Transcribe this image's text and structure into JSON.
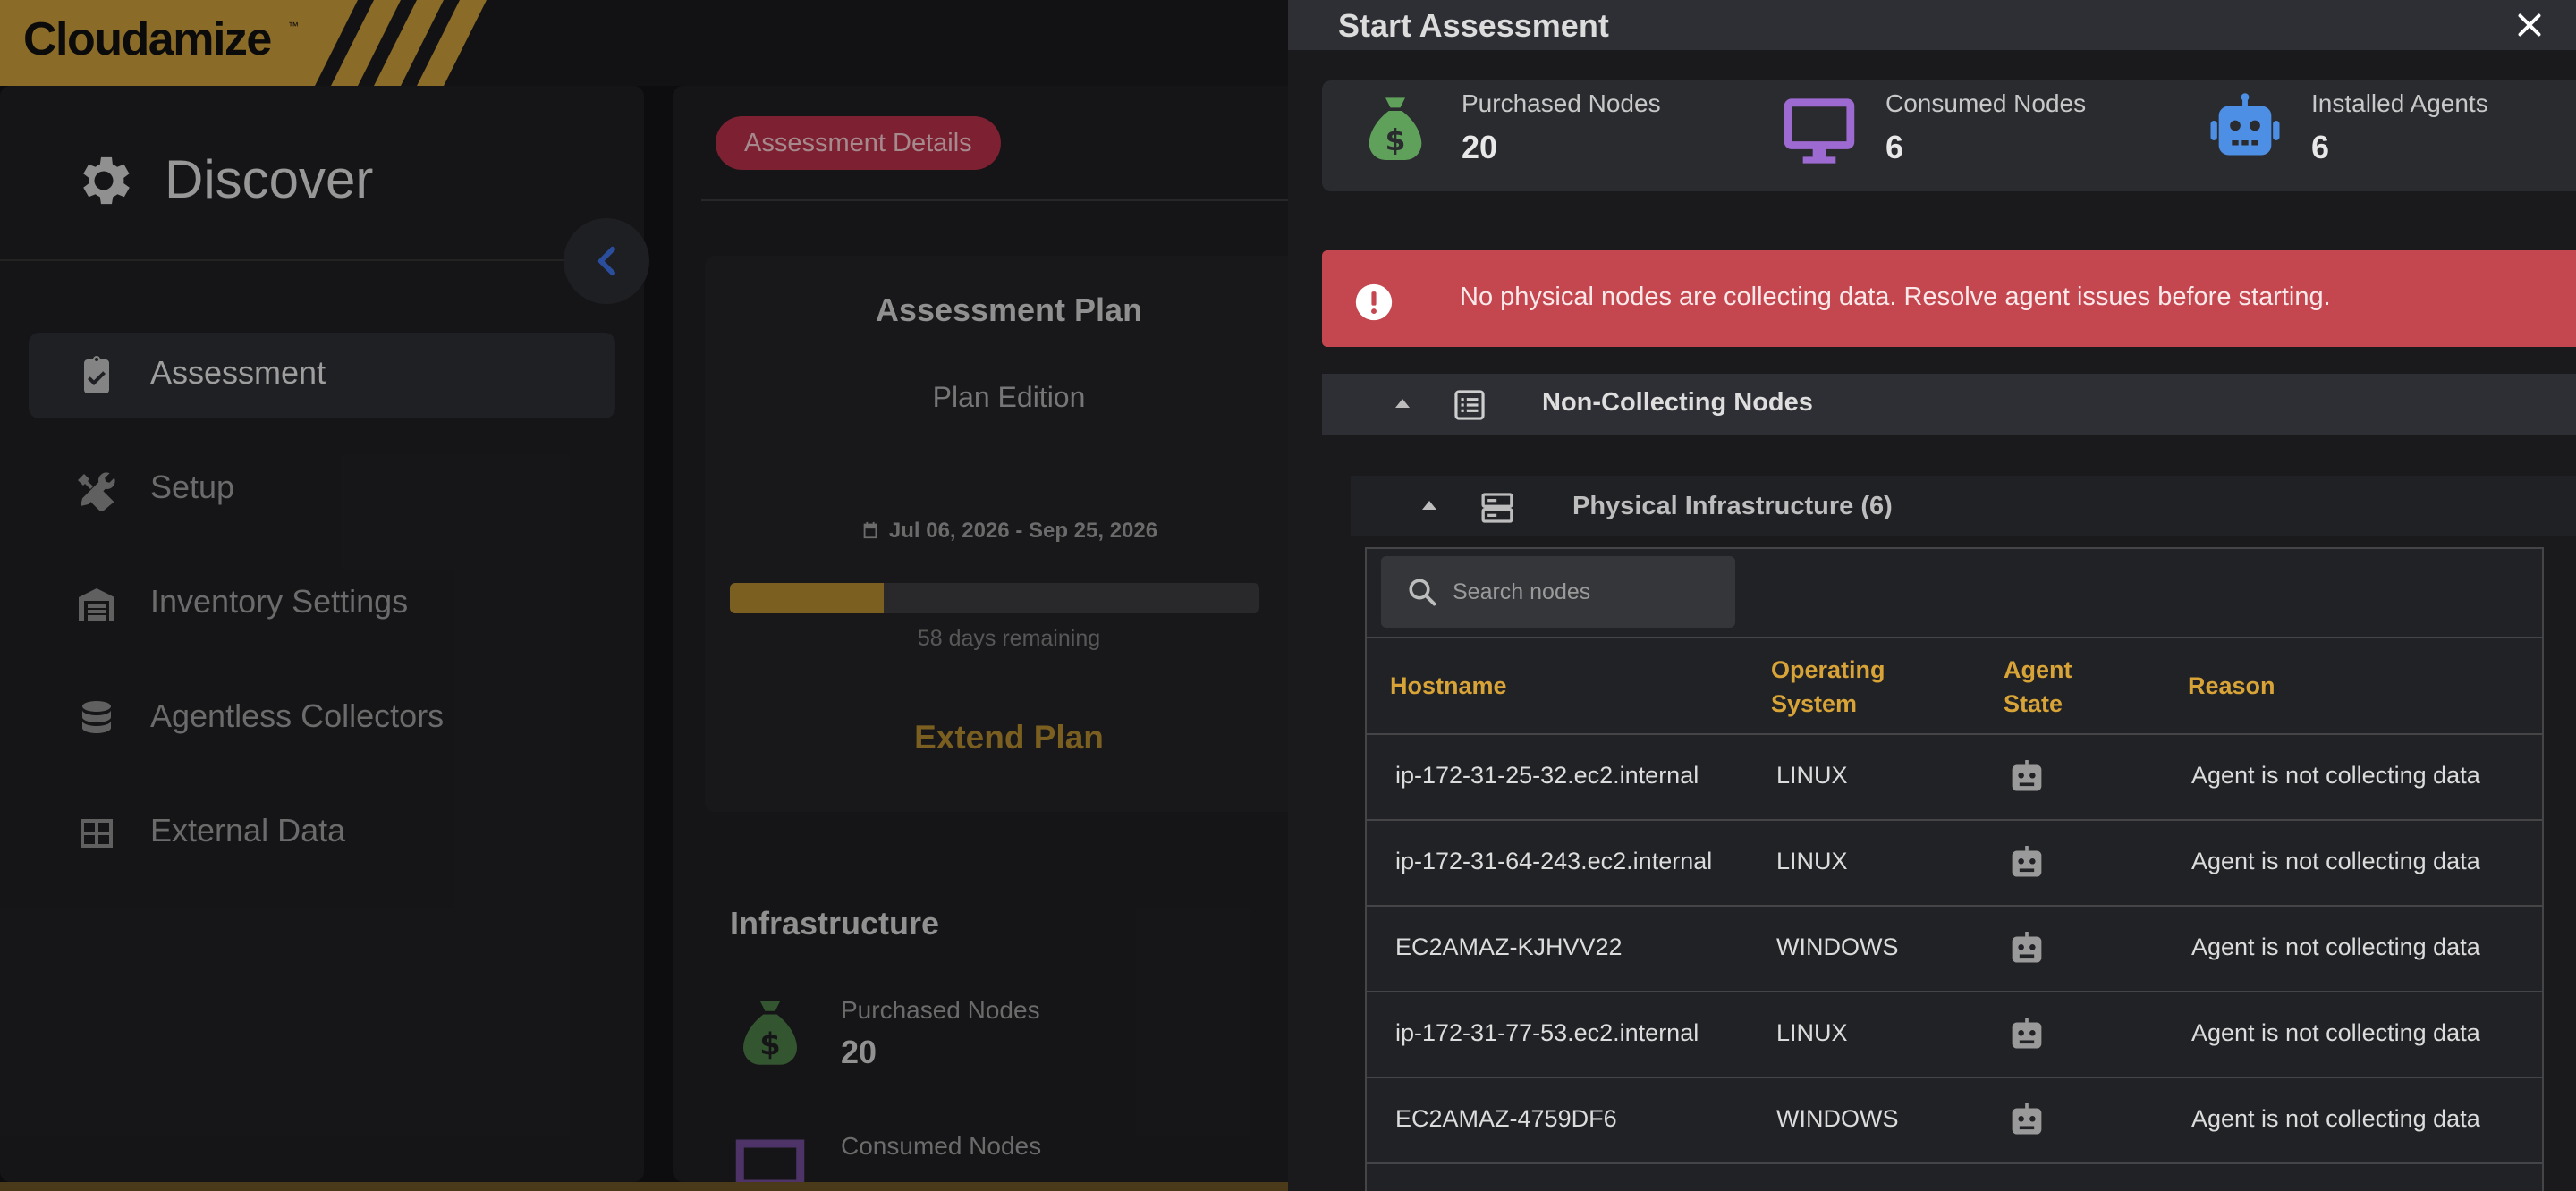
{
  "app": {
    "name": "Cloudamize",
    "trademark": "™"
  },
  "sidebar": {
    "title": "Discover",
    "items": [
      {
        "label": "Assessment",
        "icon": "clipboard-check-icon",
        "active": true
      },
      {
        "label": "Setup",
        "icon": "tools-icon",
        "active": false
      },
      {
        "label": "Inventory Settings",
        "icon": "warehouse-icon",
        "active": false
      },
      {
        "label": "Agentless Collectors",
        "icon": "database-icon",
        "active": false
      },
      {
        "label": "External Data",
        "icon": "table-icon",
        "active": false
      }
    ]
  },
  "main": {
    "tab": "Assessment Details",
    "plan": {
      "title": "Assessment Plan",
      "edition": "Plan Edition",
      "dates": "Jul 06, 2026 - Sep 25, 2026",
      "progress_percent": 29,
      "remaining": "58 days remaining",
      "extend_label": "Extend Plan"
    },
    "infrastructure": {
      "title": "Infrastructure",
      "purchased_label": "Purchased Nodes",
      "purchased_value": "20",
      "consumed_label": "Consumed Nodes"
    }
  },
  "drawer": {
    "title": "Start Assessment",
    "close_icon": "close-icon",
    "summary": [
      {
        "label": "Purchased Nodes",
        "value": "20",
        "icon": "money-bag-icon",
        "color": "#5fa05a"
      },
      {
        "label": "Consumed Nodes",
        "value": "6",
        "icon": "monitor-icon",
        "color": "#9c6ad0"
      },
      {
        "label": "Installed Agents",
        "value": "6",
        "icon": "robot-icon",
        "color": "#4e8fe6"
      }
    ],
    "alert": "No physical nodes are collecting data. Resolve agent issues before starting.",
    "section_label": "Non-Collecting Nodes",
    "subsection_label": "Physical Infrastructure (6)",
    "search_placeholder": "Search nodes",
    "columns": [
      "Hostname",
      "Operating System",
      "Agent State",
      "Reason"
    ],
    "rows": [
      {
        "hostname": "ip-172-31-25-32.ec2.internal",
        "os": "LINUX",
        "reason": "Agent is not collecting data"
      },
      {
        "hostname": "ip-172-31-64-243.ec2.internal",
        "os": "LINUX",
        "reason": "Agent is not collecting data"
      },
      {
        "hostname": "EC2AMAZ-KJHVV22",
        "os": "WINDOWS",
        "reason": "Agent is not collecting data"
      },
      {
        "hostname": "ip-172-31-77-53.ec2.internal",
        "os": "LINUX",
        "reason": "Agent is not collecting data"
      },
      {
        "hostname": "EC2AMAZ-4759DF6",
        "os": "WINDOWS",
        "reason": "Agent is not collecting data"
      }
    ]
  },
  "colors": {
    "accent_gold": "#b0882e",
    "alert_red": "#c4464f",
    "pill_red": "#b22f48",
    "header_gold": "#d9a437"
  }
}
